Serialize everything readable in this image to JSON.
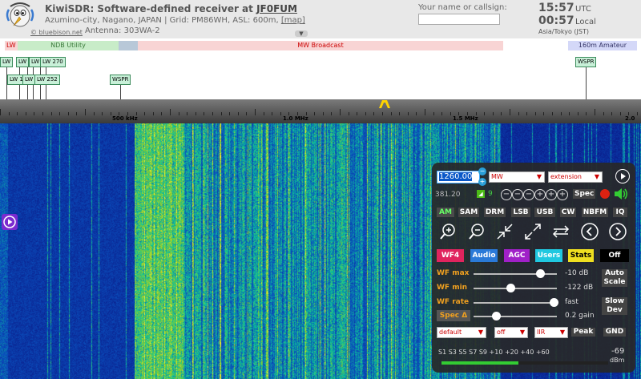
{
  "header": {
    "app_title": "KiwiSDR: Software-defined receiver at",
    "callsign": "JF0FUM",
    "location": "Azumino-city, Nagano, JAPAN | Grid: PM86WH, ASL: 600m,",
    "map_link": "[map]",
    "antenna": "Antenna: 303WA-2",
    "credit": "© bluebison.net",
    "name_label": "Your name or callsign:",
    "name_value": "",
    "utc_time": "15:57",
    "utc_label": "UTC",
    "local_time": "00:57",
    "local_label": "Local",
    "timezone": "Asia/Tokyo (JST)"
  },
  "bands": {
    "lw": "LW",
    "ndb": "NDB Utility",
    "mw": "MW Broadcast",
    "amateur160": "160m Amateur"
  },
  "stations": [
    {
      "label": "LW"
    },
    {
      "label": "LW"
    },
    {
      "label": "LW 270"
    },
    {
      "label": "LW"
    },
    {
      "label": "LW 1"
    },
    {
      "label": "LW"
    },
    {
      "label": "LW 252"
    },
    {
      "label": "WSPR"
    },
    {
      "label": "WSPR"
    }
  ],
  "scale": {
    "label_500": "500 kHz",
    "label_1m": "1.0 MHz",
    "label_15m": "1.5 MHz",
    "label_2m": "2.0"
  },
  "panel": {
    "frequency": "1260.00",
    "mode_select": "MW",
    "extension_select": "extension",
    "bandwidth": "381.20",
    "agc_value": "9",
    "spec_label": "Spec",
    "modes": [
      "AM",
      "SAM",
      "DRM",
      "LSB",
      "USB",
      "CW",
      "NBFM",
      "IQ"
    ],
    "active_mode": "AM",
    "color_buttons": {
      "wf4": "WF4",
      "audio": "Audio",
      "agc": "AGC",
      "users": "Users",
      "stats": "Stats",
      "off": "Off"
    },
    "wf_max_label": "WF max",
    "wf_max_value": "-10 dB",
    "wf_max_level": 0.82,
    "wf_min_label": "WF min",
    "wf_min_value": "-122 dB",
    "wf_min_level": 0.44,
    "wf_rate_label": "WF rate",
    "wf_rate_value": "fast",
    "wf_rate_level": 1.0,
    "spec_delta_label": "Spec Δ",
    "spec_gain_value": "0.2 gain",
    "spec_gain_level": 0.25,
    "auto_scale": "Auto Scale",
    "slow_dev": "Slow Dev",
    "peak": "Peak",
    "gnd": "GND",
    "select_default": "default",
    "select_off": "off",
    "select_iir": "IIR",
    "smeter_labels": "S1  S3  S5  S7  S9 +10 +20   +40   +60",
    "smeter_value": "-69",
    "smeter_unit": "dBm",
    "smeter_level": 0.46
  }
}
